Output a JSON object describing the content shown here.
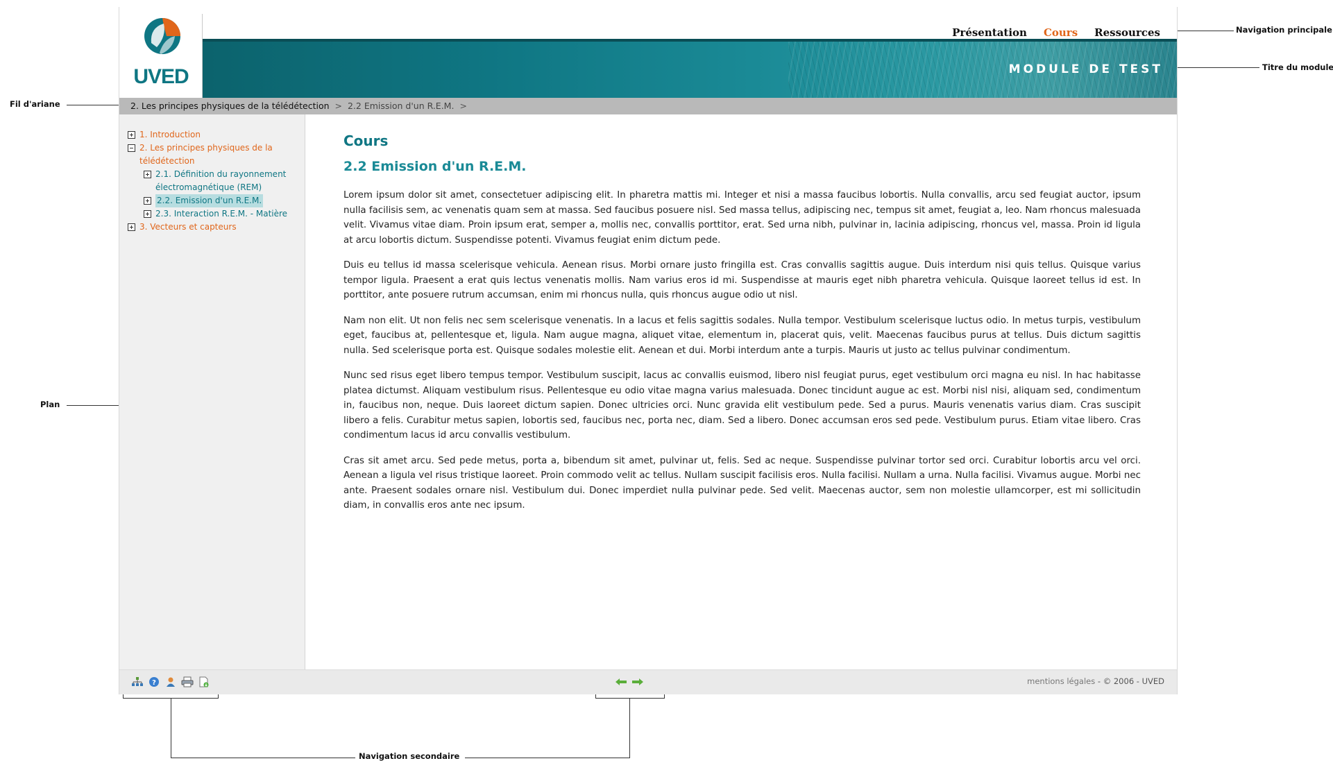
{
  "nav": {
    "items": [
      {
        "label": "Présentation",
        "active": false
      },
      {
        "label": "Cours",
        "active": true
      },
      {
        "label": "Ressources",
        "active": false
      }
    ]
  },
  "header": {
    "logo_text": "UVED",
    "module_title": "MODULE DE TEST"
  },
  "breadcrumb": {
    "items": [
      "2. Les principes physiques de la télédétection",
      "2.2 Emission d'un R.E.M."
    ],
    "separator": ">"
  },
  "sidebar": {
    "items": [
      {
        "label": "1. Introduction",
        "level": 0,
        "toggle": "plus"
      },
      {
        "label": "2. Les principes physiques de la télédétection",
        "level": 0,
        "toggle": "minus"
      },
      {
        "label": "2.1. Définition du rayonnement électromagnétique (REM)",
        "level": 1,
        "toggle": "plus"
      },
      {
        "label": "2.2. Emission d'un R.E.M.",
        "level": 1,
        "toggle": "plus",
        "current": true
      },
      {
        "label": "2.3. Interaction R.E.M. - Matière",
        "level": 1,
        "toggle": "plus"
      },
      {
        "label": "3. Vecteurs et capteurs",
        "level": 0,
        "toggle": "plus"
      }
    ]
  },
  "content": {
    "section": "Cours",
    "title": "2.2 Emission d'un R.E.M.",
    "paragraphs": [
      "Lorem ipsum dolor sit amet, consectetuer adipiscing elit. In pharetra mattis mi. Integer et nisi a massa faucibus lobortis. Nulla convallis, arcu sed feugiat auctor, ipsum nulla facilisis sem, ac venenatis quam sem at massa. Sed faucibus posuere nisl. Sed massa tellus, adipiscing nec, tempus sit amet, feugiat a, leo. Nam rhoncus malesuada velit. Vivamus vitae diam. Proin ipsum erat, semper a, mollis nec, convallis porttitor, erat. Sed urna nibh, pulvinar in, lacinia adipiscing, rhoncus vel, massa. Proin id ligula at arcu lobortis dictum. Suspendisse potenti. Vivamus feugiat enim dictum pede.",
      "Duis eu tellus id massa scelerisque vehicula. Aenean risus. Morbi ornare justo fringilla est. Cras convallis sagittis augue. Duis interdum nisi quis tellus. Quisque varius tempor ligula. Praesent a erat quis lectus venenatis mollis. Nam varius eros id mi. Suspendisse at mauris eget nibh pharetra vehicula. Quisque laoreet tellus id est. In porttitor, ante posuere rutrum accumsan, enim mi rhoncus nulla, quis rhoncus augue odio ut nisl.",
      "Nam non elit. Ut non felis nec sem scelerisque venenatis. In a lacus et felis sagittis sodales. Nulla tempor. Vestibulum scelerisque luctus odio. In metus turpis, vestibulum eget, faucibus at, pellentesque et, ligula. Nam augue magna, aliquet vitae, elementum in, placerat quis, velit. Maecenas faucibus purus at tellus. Duis dictum sagittis nulla. Sed scelerisque porta est. Quisque sodales molestie elit. Aenean et dui. Morbi interdum ante a turpis. Mauris ut justo ac tellus pulvinar condimentum.",
      "Nunc sed risus eget libero tempus tempor. Vestibulum suscipit, lacus ac convallis euismod, libero nisl feugiat purus, eget vestibulum orci magna eu nisl. In hac habitasse platea dictumst. Aliquam vestibulum risus. Pellentesque eu odio vitae magna varius malesuada. Donec tincidunt augue ac est. Morbi nisl nisi, aliquam sed, condimentum in, faucibus non, neque. Duis laoreet dictum sapien. Donec ultricies orci. Nunc gravida elit vestibulum pede. Sed a purus. Mauris venenatis varius diam. Cras suscipit libero a felis. Curabitur metus sapien, lobortis sed, faucibus nec, porta nec, diam. Sed a libero. Donec accumsan eros sed pede. Vestibulum purus. Etiam vitae libero. Cras condimentum lacus id arcu convallis vestibulum.",
      "Cras sit amet arcu. Sed pede metus, porta a, bibendum sit amet, pulvinar ut, felis. Sed ac neque. Suspendisse pulvinar tortor sed orci. Curabitur lobortis arcu vel orci. Aenean a ligula vel risus tristique laoreet. Proin commodo velit ac tellus. Nullam suscipit facilisis eros. Nulla facilisi. Nullam a urna. Nulla facilisi. Vivamus augue. Morbi nec ante. Praesent sodales ornare nisl. Vestibulum dui. Donec imperdiet nulla pulvinar pede. Sed velit. Maecenas auctor, sem non molestie ullamcorper, est mi sollicitudin diam, in convallis eros ante nec ipsum."
    ]
  },
  "footer": {
    "tools": [
      "sitemap-icon",
      "help-icon",
      "user-icon",
      "print-icon",
      "download-icon"
    ],
    "arrows": [
      "arrow-left-icon",
      "arrow-right-icon"
    ],
    "legal_link": "mentions légales",
    "copyright": " - © 2006 - UVED"
  },
  "annotations": {
    "main_nav": "Navigation principale",
    "module_title": "Titre du module",
    "breadcrumb": "Fil d'ariane",
    "plan": "Plan",
    "secondary_nav": "Navigation secondaire"
  },
  "colors": {
    "accent_orange": "#e0661b",
    "teal": "#0f7683",
    "breadcrumb_bg": "#b9b9b9",
    "sidebar_bg": "#f0f0f0"
  }
}
